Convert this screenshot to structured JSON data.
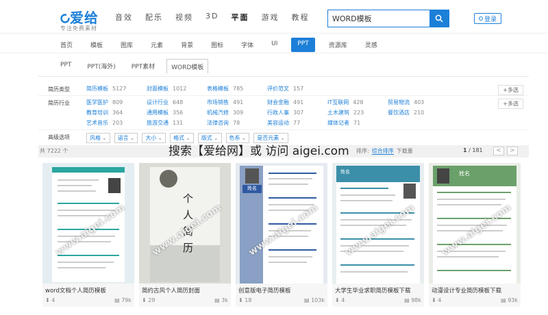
{
  "brand": {
    "name": "爱给",
    "slogan": "专注免费素材"
  },
  "main_nav": [
    "音效",
    "配乐",
    "视频",
    "3D",
    "平面",
    "游戏",
    "教程"
  ],
  "main_nav_active": "平面",
  "search": {
    "value": "WORD模板"
  },
  "login_label": "登录",
  "sub_nav": [
    "首页",
    "模板",
    "图库",
    "元素",
    "背景",
    "图标",
    "字体",
    "UI",
    "PPT",
    "资源库",
    "灵感"
  ],
  "sub_nav_active": "PPT",
  "tabs": [
    "PPT",
    "PPT(海外)",
    "PPT素材",
    "WORD模板"
  ],
  "tabs_active": "WORD模板",
  "filters": [
    {
      "label": "简历类型",
      "more": "+多选",
      "items": [
        {
          "name": "简历模板",
          "count": "5127"
        },
        {
          "name": "封面模板",
          "count": "1012"
        },
        {
          "name": "表格模板",
          "count": "785"
        },
        {
          "name": "评价范文",
          "count": "157"
        }
      ]
    },
    {
      "label": "简历行业",
      "more": "+多选",
      "items": [
        {
          "name": "医学医护",
          "count": "809"
        },
        {
          "name": "设计行业",
          "count": "648"
        },
        {
          "name": "市场销售",
          "count": "491"
        },
        {
          "name": "财会金融",
          "count": "491"
        },
        {
          "name": "IT互联网",
          "count": "428"
        },
        {
          "name": "贸易物流",
          "count": "403"
        },
        {
          "name": "教育培训",
          "count": "364"
        },
        {
          "name": "通用模板",
          "count": "356"
        },
        {
          "name": "机械汽修",
          "count": "309"
        },
        {
          "name": "行政人事",
          "count": "307"
        },
        {
          "name": "土木建筑",
          "count": "223"
        },
        {
          "name": "餐饮酒店",
          "count": "210"
        },
        {
          "name": "艺术音乐",
          "count": "203"
        },
        {
          "name": "旅游交通",
          "count": "131"
        },
        {
          "name": "法律咨询",
          "count": "78"
        },
        {
          "name": "美容运动",
          "count": "77"
        },
        {
          "name": "媒体记者",
          "count": "71"
        }
      ]
    },
    {
      "label": "高级选项",
      "options": [
        "风格",
        "语言",
        "大小",
        "格式",
        "版式",
        "色系",
        "是否元素"
      ]
    }
  ],
  "result": {
    "count_text": "共 7222 个",
    "banner": "搜索【爱给网】或 访问 aigei.com",
    "sort_label": "排序:",
    "sort_active": "综合排序",
    "sort_other": "下载量",
    "page_current": "1",
    "page_total": "/ 181",
    "prev": "<",
    "next": ">"
  },
  "cards": [
    {
      "title": "word文档个人简历模板",
      "downloads": "4",
      "size": "79k"
    },
    {
      "title": "简约古风个人简历封面",
      "downloads": "29",
      "size": "3k"
    },
    {
      "title": "创意版电子简历模板",
      "downloads": "18",
      "size": "103k"
    },
    {
      "title": "大学生毕业求职简历模板下载",
      "downloads": "4",
      "size": "98k"
    },
    {
      "title": "动漫设计专业简历模板下载",
      "downloads": "4",
      "size": "93k"
    }
  ],
  "card_thumb_texts": {
    "portrait_name": "姓名",
    "vertical_title": "个人简历",
    "watermark": "www.aigei.com"
  },
  "colors": {
    "accent": "#1c7fd8"
  }
}
